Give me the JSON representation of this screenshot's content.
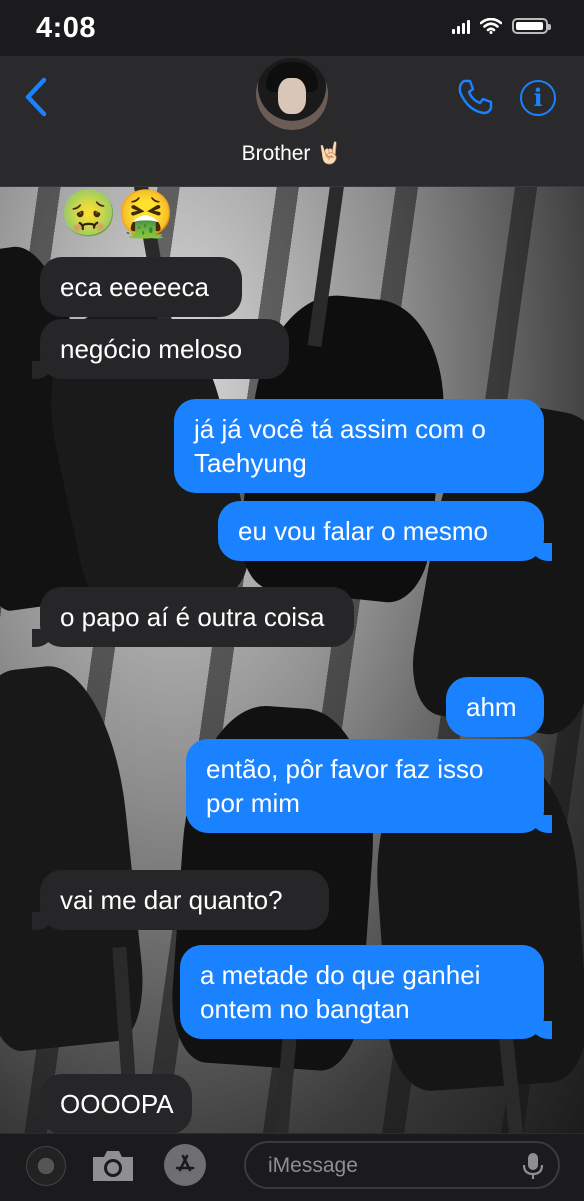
{
  "status_bar": {
    "time": "4:08",
    "battery_level": 0.95
  },
  "header": {
    "contact_name": "Brother 🤘🏻"
  },
  "conversation": {
    "reactions": "🤢🤮",
    "messages": [
      {
        "direction": "incoming",
        "text": "eca eeeeeca"
      },
      {
        "direction": "incoming",
        "text": "negócio meloso"
      },
      {
        "direction": "outgoing",
        "text": "já já você tá assim com o Taehyung"
      },
      {
        "direction": "outgoing",
        "text": "eu vou falar o mesmo"
      },
      {
        "direction": "incoming",
        "text": "o papo aí é outra coisa"
      },
      {
        "direction": "outgoing",
        "text": "ahm"
      },
      {
        "direction": "outgoing",
        "text": "então, pôr favor faz isso por mim"
      },
      {
        "direction": "incoming",
        "text": "vai me dar quanto?"
      },
      {
        "direction": "outgoing",
        "text": "a metade do que ganhei ontem no bangtan"
      },
      {
        "direction": "incoming",
        "text": "OOOOPA"
      }
    ]
  },
  "input_bar": {
    "placeholder": "iMessage"
  },
  "colors": {
    "accent": "#1a82ff",
    "incoming_bubble": "#262628",
    "outgoing_bubble": "#1a82ff",
    "header_bg": "#2a2a2c"
  }
}
